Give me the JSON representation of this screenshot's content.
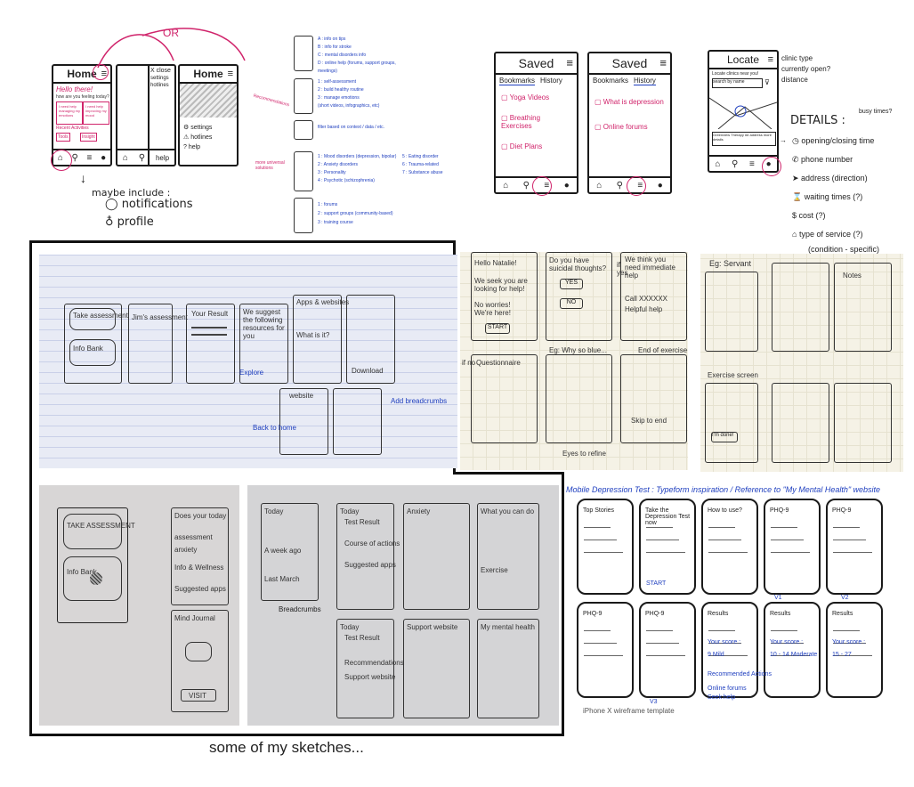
{
  "caption": "some of my sketches...",
  "top": {
    "home_sketch": {
      "title": "Home",
      "title2": "Home",
      "or_label": "OR",
      "greeting": "Hello there!",
      "question": "how are you feeling today?",
      "card1": "I need help managing my emotions",
      "card2": "I need help improving my mood",
      "recent": "Recent Activities",
      "chip1": "Tools",
      "chip2": "Insight",
      "drawer_close": "X close",
      "drawer_settings": "settings",
      "drawer_hotlines": "hotlines",
      "drawer_help": "help",
      "menu_settings": "settings",
      "menu_hotlines": "hotlines",
      "menu_help": "help",
      "help_footer": "help",
      "maybe": "maybe include :",
      "notifications": "notifications",
      "profile": "profile"
    },
    "list_notes": {
      "a": "A : info on tips",
      "b": "B : info for stroke",
      "c": "C : mental disorders info",
      "d": "D : online help (forums, support groups, meetings)",
      "e": "1 : self-assessment",
      "f": "2 : build healthy routine",
      "g": "3 : manage emotions",
      "h": "(short videos, infographics, etc)",
      "i": "filter based on context / data / etc.",
      "side1": "Recommendations",
      "side2": "more universal solutions",
      "j1": "1 : Mood disorders (depression, bipolar)",
      "j2": "2 : Anxiety disorders",
      "j3": "3 : Personality",
      "j4": "4 : Psychotic (schizophrenia)",
      "k1": "5 : Eating disorder",
      "k2": "6 : Trauma-related",
      "k3": "7 : Substance abuse",
      "l1": "1 : forums",
      "l2": "2 : support groups (community-based)",
      "l3": "3 : training course"
    },
    "saved": {
      "title": "Saved",
      "tab1": "Bookmarks",
      "tab2": "History",
      "item1": "Yoga Videos",
      "item2": "Breathing Exercises",
      "item3": "Diet Plans",
      "hist1": "What is depression",
      "hist2": "Online forums"
    },
    "locate": {
      "title": "Locate",
      "search_hint": "Locate clinics near you!",
      "search_placeholder": "search by name",
      "clinic": "Greenview Therapy ## address more details",
      "note1": "clinic type",
      "note2": "currently open?",
      "note3": "distance",
      "details": "DETAILS :",
      "busy": "busy times?",
      "d1": "opening/closing time",
      "d2": "phone number",
      "d3": "address (direction)",
      "d4": "waiting times (?)",
      "d5": "cost          (?)",
      "d6": "type of service (?)",
      "d7": "(condition - specific)"
    }
  },
  "mid": {
    "paper1_notes": [
      "Take assessment",
      "Info Bank",
      "Jim's assessment",
      "Your Result",
      "We suggest the following resources for you",
      "Apps & websites",
      "Explore",
      "website",
      "What is it?",
      "Download",
      "Add breadcrumbs",
      "Back to home"
    ],
    "canvas1": {
      "c1": "Hello Natalie!",
      "c2": "We seek you are looking for help!",
      "c3": "No worries! We're here!",
      "btn_start": "START",
      "c4": "Do you have suicidal thoughts?",
      "yes": "YES",
      "no": "NO",
      "if_yes": "if yes",
      "c5": "We think you need immediate help",
      "c6": "Call XXXXXX",
      "c7": "Helpful help",
      "if_no": "if no",
      "questionnaire": "Questionnaire",
      "eg": "Eg: Why so blue...",
      "end": "End of exercise",
      "skip": "Skip to end",
      "eyes": "Eyes to refine"
    },
    "canvas2": {
      "title": "Eg: Servant",
      "exercise": "Exercise screen",
      "done": "I'm done!",
      "notes": "Notes"
    }
  },
  "bottom": {
    "mobile_title": "Mobile Depression Test : Typeform inspiration / Reference to \"My Mental Health\" website",
    "iphone_label": "iPhone X wireframe template",
    "screens_row1": [
      "Top Stories",
      "Take the Depression Test now",
      "How to use?",
      "PHQ-9",
      "PHQ-9"
    ],
    "screens_row2": [
      "PHQ-9",
      "PHQ-9",
      "Results",
      "Results",
      "Results"
    ],
    "your_score": "Your score :",
    "score_a": "9 Mild",
    "score_b": "10 - 14 Moderate",
    "score_c": "15 - 27",
    "recommended": "Recommended Actions",
    "online_forums": "Online forums",
    "seek_help": "Seek help",
    "start": "START",
    "v1": "V1",
    "v2": "V2",
    "v3": "V3",
    "photo2_labels": [
      "TAKE ASSESSMENT",
      "Info Bank",
      "Does your today",
      "assessment",
      "anxiety",
      "Info & Wellness",
      "Suggested apps",
      "Mind Journal",
      "VISIT"
    ],
    "photo3_labels": [
      "Today",
      "A week ago",
      "Last March",
      "Today",
      "Test Result",
      "Course of actions",
      "Suggested apps",
      "Anxiety",
      "What you can do",
      "Exercise",
      "Breadcrumbs",
      "Today",
      "Test Result",
      "Recommendations",
      "Support website",
      "Support website",
      "My mental health"
    ]
  },
  "colors": {
    "ink": "#1a1a1a",
    "pink": "#d0246b",
    "blue": "#1f3fbf",
    "paper": "#f5f2e6",
    "notebook": "#e8ebf5"
  }
}
